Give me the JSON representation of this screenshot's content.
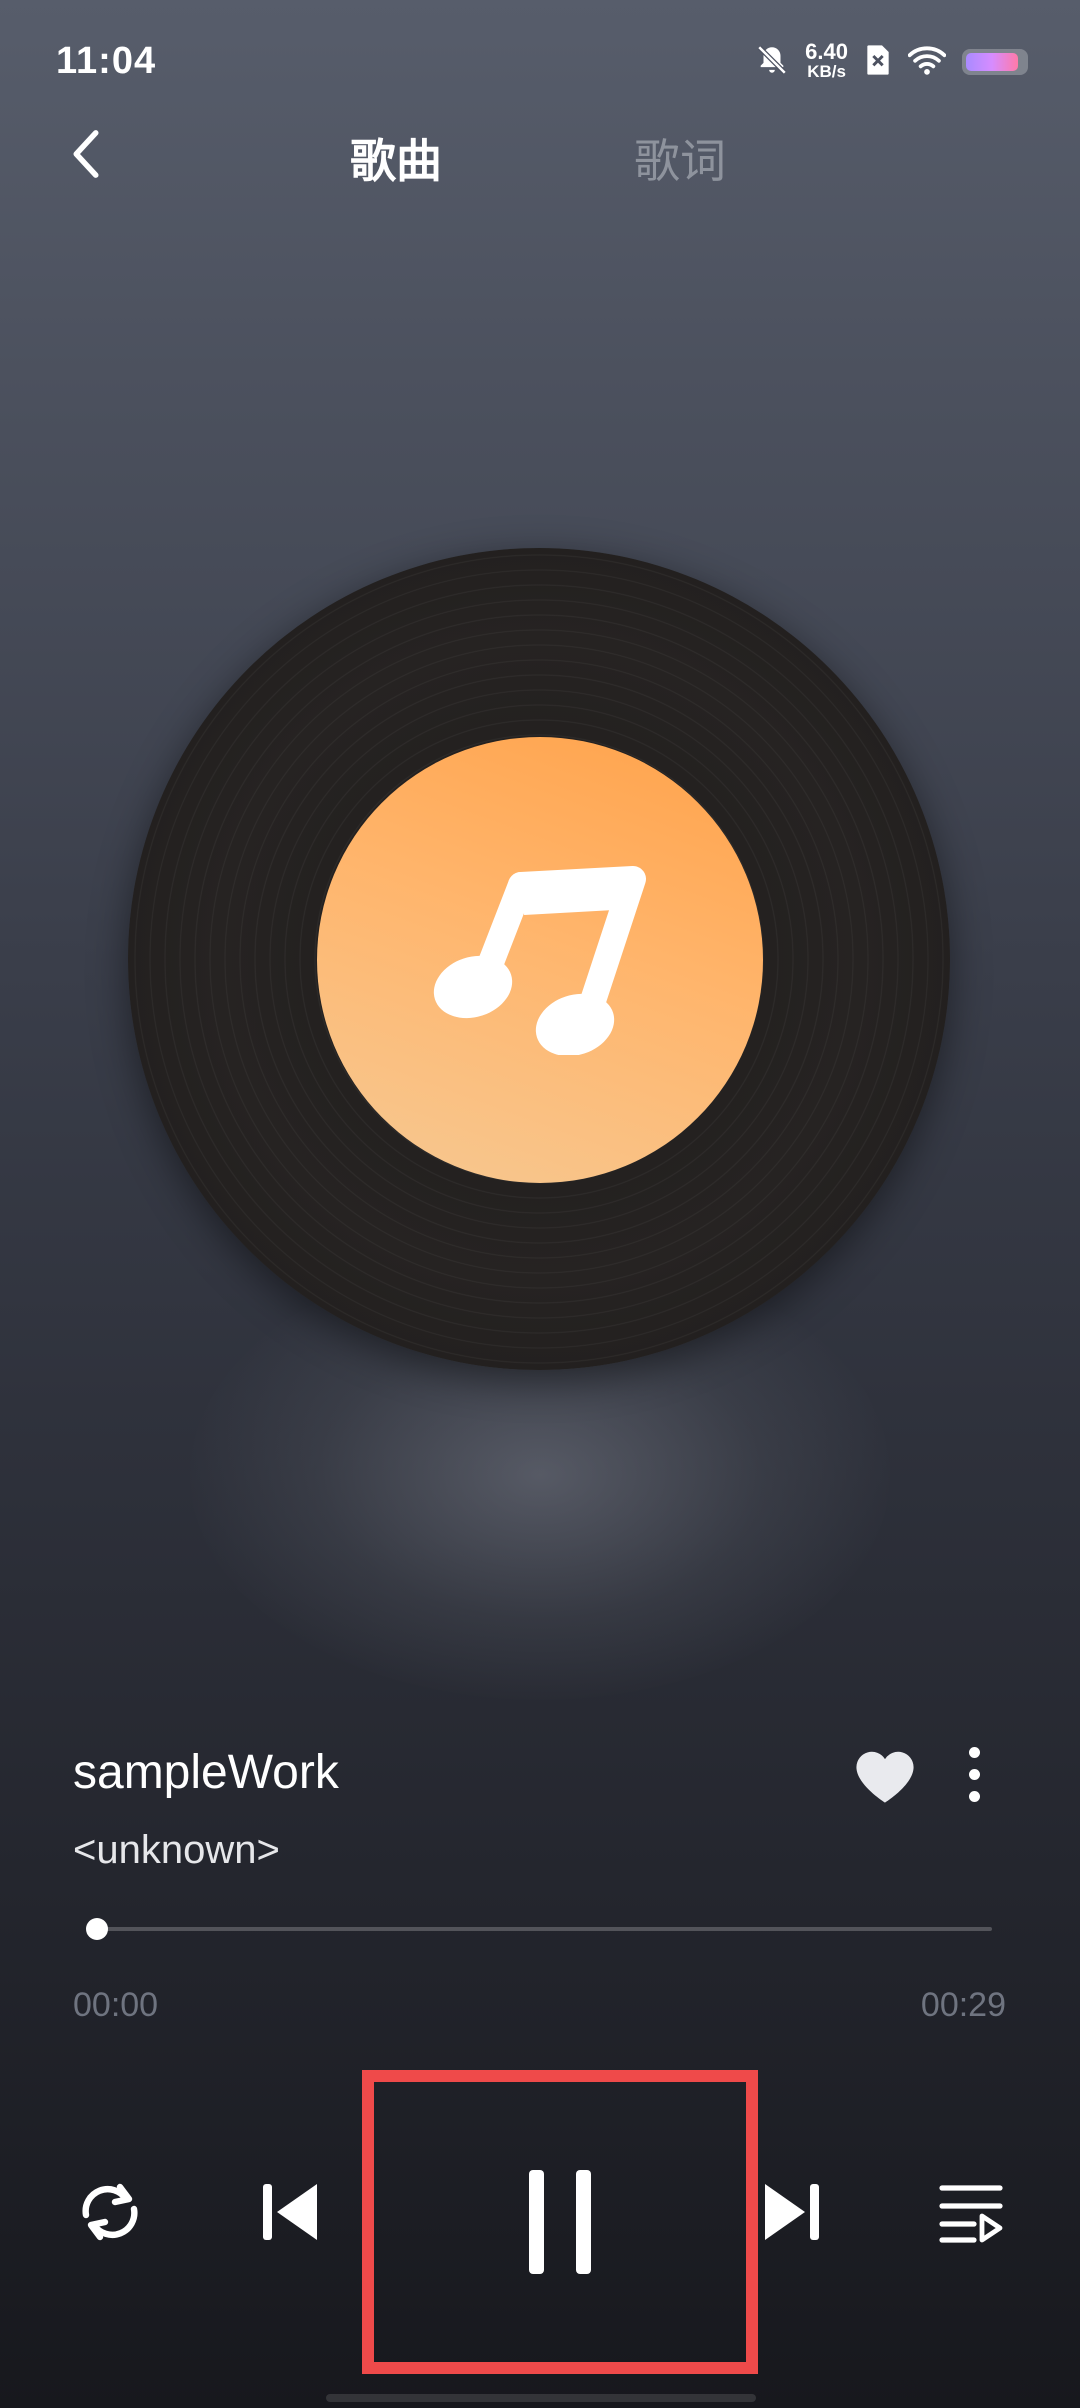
{
  "status_bar": {
    "time": "11:04",
    "net_speed_value": "6.40",
    "net_speed_unit": "KB/s",
    "icons": [
      "bell-off-icon",
      "sim-x-icon",
      "wifi-icon",
      "battery-icon"
    ]
  },
  "header": {
    "back_icon": "chevron-left-icon",
    "tabs": [
      {
        "label": "歌曲",
        "active": true
      },
      {
        "label": "歌词",
        "active": false
      }
    ]
  },
  "artwork": {
    "icon": "music-note-icon",
    "colors": {
      "label_top": "#ffa24a",
      "label_bottom": "#f6c993",
      "vinyl": "#1e1c1b"
    }
  },
  "track": {
    "title": "sampleWork",
    "artist": "<unknown>",
    "favorite_icon": "heart-icon",
    "more_icon": "more-vertical-icon"
  },
  "progress": {
    "current": "00:00",
    "total": "00:29",
    "fraction": 0.01
  },
  "controls": {
    "repeat": "repeat-icon",
    "previous": "skip-previous-icon",
    "play_pause": "pause-icon",
    "next": "skip-next-icon",
    "queue": "playlist-icon",
    "highlight_color": "#ef4a4a"
  }
}
